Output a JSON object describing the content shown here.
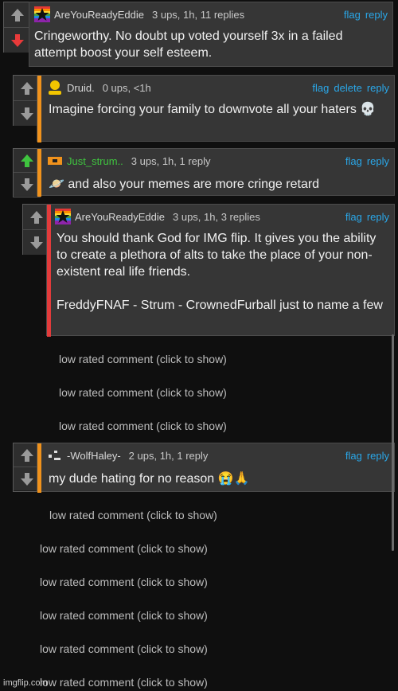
{
  "comments": [
    {
      "username": "AreYouReadyEddie",
      "meta": "3 ups, 1h, 11 replies",
      "actions": [
        "flag",
        "reply"
      ],
      "text": "Cringeworthy. No doubt up voted yourself 3x in a failed attempt boost your self esteem.",
      "vote": "down"
    },
    {
      "username": "Druid.",
      "meta": "0 ups, <1h",
      "actions": [
        "flag",
        "delete",
        "reply"
      ],
      "text": "Imagine forcing your family to downvote all your haters 💀"
    },
    {
      "username": "Just_strum..",
      "meta": "3 ups, 1h, 1 reply",
      "actions": [
        "flag",
        "reply"
      ],
      "text": "🪐 and also your memes are more cringe retard",
      "vote": "up"
    },
    {
      "username": "AreYouReadyEddie",
      "meta": "3 ups, 1h, 3 replies",
      "actions": [
        "flag",
        "reply"
      ],
      "text": "You should thank God for IMG flip. It gives you the ability to create a plethora of alts to take the place of your non-existent real life friends.\n\nFreddyFNAF - Strum - CrownedFurball just to name a few"
    },
    {
      "username": "-WolfHaley-",
      "meta": "2 ups, 1h, 1 reply",
      "actions": [
        "flag",
        "reply"
      ],
      "text": "my dude hating for no reason 😭🙏"
    }
  ],
  "low_rated_label": "low rated comment (click to show)",
  "watermark": "imgflip.com",
  "colors": {
    "link": "#2aa7e8",
    "orange_bar": "#f0921c",
    "red_bar": "#e23b3b",
    "upvote_active": "#3fc43f",
    "downvote_active": "#e83a3a"
  }
}
